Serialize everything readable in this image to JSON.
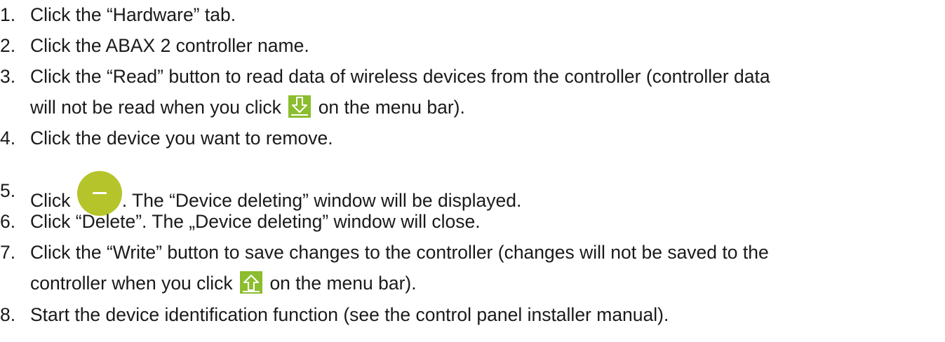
{
  "steps": [
    {
      "num": "1.",
      "text": "Click the “Hardware” tab."
    },
    {
      "num": "2.",
      "text": "Click the ABAX 2 controller name."
    },
    {
      "num": "3.",
      "line1": "Click the “Read” button to read data of wireless devices from the controller (controller data",
      "line2_before": "will not be read when you click",
      "line2_after": "on the menu bar).",
      "icon": "download-arrow-icon"
    },
    {
      "num": "4.",
      "text": "Click the device you want to remove."
    },
    {
      "num": "5.",
      "before": "Click",
      "after": ". The “Device deleting” window will be displayed.",
      "icon": "minus-circle-icon"
    },
    {
      "num": "6.",
      "text": "Click “Delete”. The „Device deleting” window will close."
    },
    {
      "num": "7.",
      "line1": "Click the “Write” button to save changes to the controller (changes will not be saved to the",
      "line2_before": "controller when you click",
      "line2_after": "on the menu bar).",
      "icon": "upload-arrow-icon"
    },
    {
      "num": "8.",
      "text": "Start the device identification function (see the control panel installer manual)."
    }
  ],
  "colors": {
    "text": "#1a1a1a",
    "arrow_icon_bg": "#8bbd2e",
    "minus_icon_bg": "#b5c42a"
  }
}
